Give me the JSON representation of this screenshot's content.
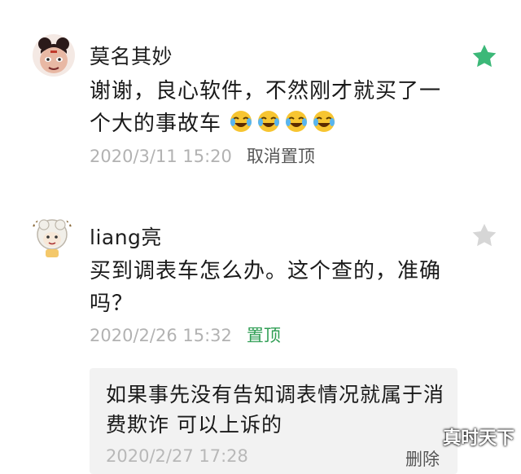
{
  "comments": [
    {
      "username": "莫名其妙",
      "avatar": "nezha-cartoon-avatar",
      "content": "谢谢，良心软件，不然刚才就买了一个大的事故车",
      "emoji_count": 4,
      "emoji": "laughing-tears-emoji",
      "time": "2020/3/11 15:20",
      "action": "取消置顶",
      "starred": true,
      "star_color": "#3cb878"
    },
    {
      "username": "liang亮",
      "avatar": "sheep-cartoon-avatar",
      "content": "买到调表车怎么办。这个查的，准确吗？",
      "time": "2020/2/26 15:32",
      "action": "置顶",
      "starred": false,
      "star_color": "#d6d6d6"
    }
  ],
  "reply": {
    "content": "如果事先没有告知调表情况就属于消费欺诈 可以上诉的",
    "time": "2020/2/27 17:28",
    "action": "删除"
  },
  "watermark": "真时天下"
}
